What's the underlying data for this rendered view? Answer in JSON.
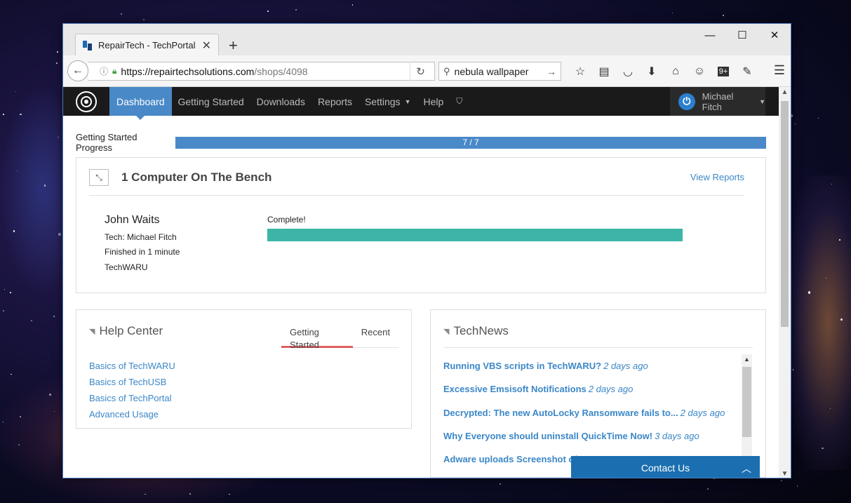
{
  "browser": {
    "tab_title": "RepairTech - TechPortal",
    "tab_close": "✕",
    "new_tab": "+",
    "window_controls": {
      "minimize": "—",
      "maximize": "☐",
      "close": "✕"
    },
    "url_host": "https://repairtechsolutions.com",
    "url_path": "/shops/4098",
    "search_value": "nebula wallpaper",
    "toolbar_icons": [
      "star-icon",
      "reader-icon",
      "pocket-icon",
      "download-icon",
      "home-icon",
      "chat-icon",
      "notifications-icon",
      "tools-icon",
      "menu-icon"
    ],
    "notification_badge": "9+"
  },
  "site": {
    "nav": {
      "items": [
        "Dashboard",
        "Getting Started",
        "Downloads",
        "Reports",
        "Settings",
        "Help"
      ],
      "active": "Dashboard",
      "user_name": "Michael Fitch"
    },
    "progress": {
      "label": "Getting Started Progress",
      "text": "7 / 7",
      "fraction": 1.0
    },
    "bench": {
      "title": "1 Computer On The Bench",
      "view_reports": "View Reports",
      "job": {
        "name": "John Waits",
        "tech": "Tech: Michael Fitch",
        "finished": "Finished in 1 minute",
        "tool": "TechWARU",
        "status": "Complete!",
        "progress_fraction": 1.0
      }
    },
    "help_center": {
      "title": "Help Center",
      "tabs": [
        "Getting Started",
        "Recent"
      ],
      "active_tab": "Getting Started",
      "links": [
        "Basics of TechWARU",
        "Basics of TechUSB",
        "Basics of TechPortal",
        "Advanced Usage"
      ]
    },
    "technews": {
      "title": "TechNews",
      "items": [
        {
          "title": "Running VBS scripts in TechWARU?",
          "time": "2 days ago"
        },
        {
          "title": "Excessive Emsisoft Notifications",
          "time": "2 days ago"
        },
        {
          "title": "Decrypted: The new AutoLocky Ransomware fails to...",
          "time": "2 days ago"
        },
        {
          "title": "Why Everyone should uninstall QuickTime Now!",
          "time": "3 days ago"
        },
        {
          "title": "Adware uploads Screenshot of y...",
          "time": ""
        }
      ]
    },
    "contact": {
      "label": "Contact Us"
    }
  },
  "colors": {
    "accent": "#4a89c8",
    "nav_bg": "#1a1a1a",
    "job_bar": "#3db5a6",
    "link": "#3b87c7",
    "contact_bg": "#1b6fb0"
  }
}
